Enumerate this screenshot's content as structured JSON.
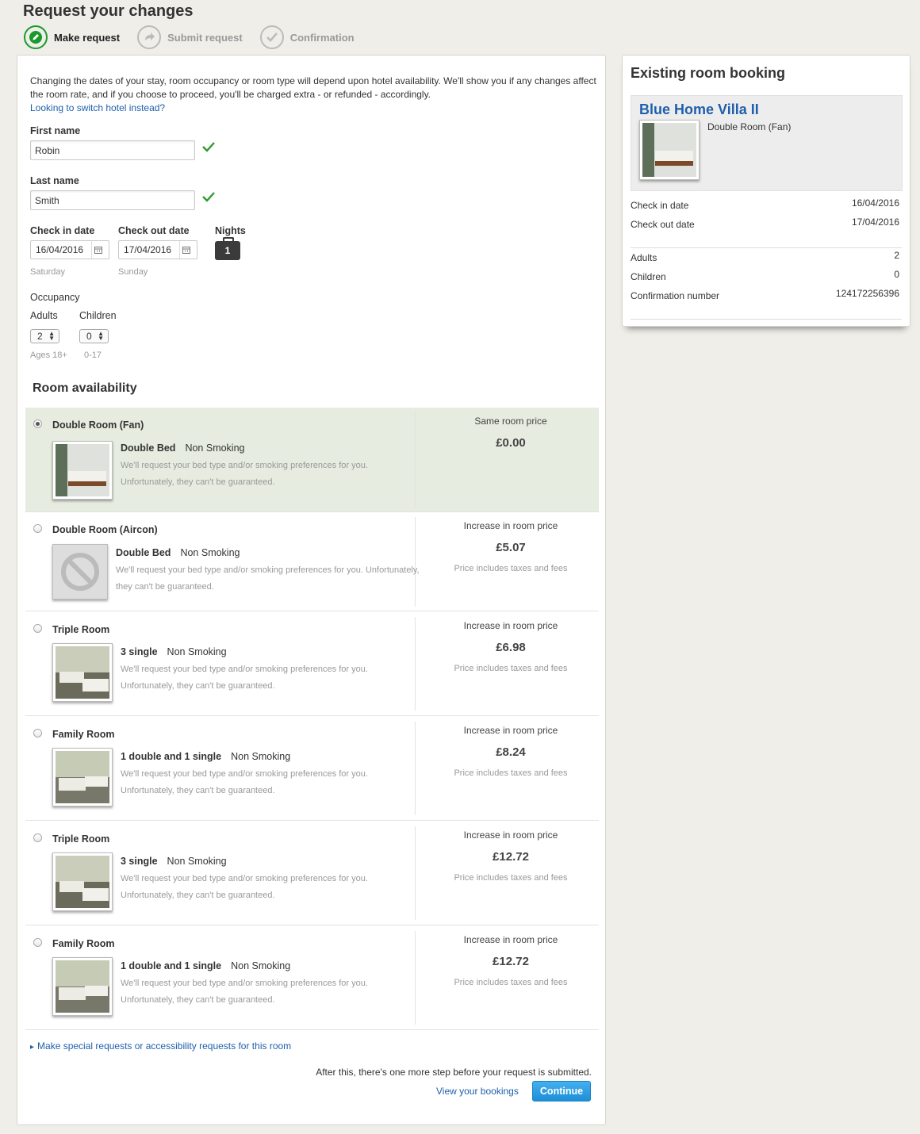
{
  "page_title": "Request your changes",
  "steps": [
    {
      "label": "Make request"
    },
    {
      "label": "Submit request"
    },
    {
      "label": "Confirmation"
    }
  ],
  "intro": {
    "text": "Changing the dates of your stay, room occupancy or room type will depend upon hotel availability. We'll show you if any changes affect the room rate, and if you choose to proceed, you'll be charged extra - or refunded - accordingly.",
    "switch_link": "Looking to switch hotel instead?"
  },
  "form": {
    "first_name_label": "First name",
    "first_name_value": "Robin",
    "last_name_label": "Last name",
    "last_name_value": "Smith",
    "check_in_label": "Check in date",
    "check_in_value": "16/04/2016",
    "check_in_day": "Saturday",
    "check_out_label": "Check out date",
    "check_out_value": "17/04/2016",
    "check_out_day": "Sunday",
    "nights_label": "Nights",
    "nights_value": "1",
    "occupancy_label": "Occupancy",
    "adults_label": "Adults",
    "adults_value": "2",
    "adults_hint": "Ages 18+",
    "children_label": "Children",
    "children_value": "0",
    "children_hint": "0-17"
  },
  "room_availability_title": "Room availability",
  "rooms": [
    {
      "name": "Double Room (Fan)",
      "bed": "Double Bed",
      "smoking": "Non Smoking",
      "note1": "We'll request your bed type and/or smoking preferences for you.",
      "note2": "Unfortunately, they can't be guaranteed.",
      "price_head": "Same room price",
      "price": "£0.00",
      "price_note": ""
    },
    {
      "name": "Double Room (Aircon)",
      "bed": "Double Bed",
      "smoking": "Non Smoking",
      "note1": "We'll request your bed type and/or smoking preferences for you. Unfortunately,",
      "note2": "they can't be guaranteed.",
      "price_head": "Increase in room price",
      "price": "£5.07",
      "price_note": "Price includes taxes and fees"
    },
    {
      "name": "Triple Room",
      "bed": "3 single",
      "smoking": "Non Smoking",
      "note1": "We'll request your bed type and/or smoking preferences for you.",
      "note2": "Unfortunately, they can't be guaranteed.",
      "price_head": "Increase in room price",
      "price": "£6.98",
      "price_note": "Price includes taxes and fees"
    },
    {
      "name": "Family Room",
      "bed": "1 double and 1 single",
      "smoking": "Non Smoking",
      "note1": "We'll request your bed type and/or smoking preferences for you.",
      "note2": "Unfortunately, they can't be guaranteed.",
      "price_head": "Increase in room price",
      "price": "£8.24",
      "price_note": "Price includes taxes and fees"
    },
    {
      "name": "Triple Room",
      "bed": "3 single",
      "smoking": "Non Smoking",
      "note1": "We'll request your bed type and/or smoking preferences for you.",
      "note2": "Unfortunately, they can't be guaranteed.",
      "price_head": "Increase in room price",
      "price": "£12.72",
      "price_note": "Price includes taxes and fees"
    },
    {
      "name": "Family Room",
      "bed": "1 double and 1 single",
      "smoking": "Non Smoking",
      "note1": "We'll request your bed type and/or smoking preferences for you.",
      "note2": "Unfortunately, they can't be guaranteed.",
      "price_head": "Increase in room price",
      "price": "£12.72",
      "price_note": "Price includes taxes and fees"
    }
  ],
  "special_requests_link": "Make special requests or accessibility requests for this room",
  "after_text": "After this, there's one more step before your request is submitted.",
  "view_bookings_link": "View your bookings",
  "continue_label": "Continue",
  "existing": {
    "title": "Existing room booking",
    "hotel_name": "Blue Home Villa II",
    "room_type": "Double Room (Fan)",
    "check_in_label": "Check in date",
    "check_in_value": "16/04/2016",
    "check_out_label": "Check out date",
    "check_out_value": "17/04/2016",
    "adults_label": "Adults",
    "adults_value": "2",
    "children_label": "Children",
    "children_value": "0",
    "confirmation_label": "Confirmation number",
    "confirmation_value": "124172256396"
  },
  "colors": {
    "accent_green": "#1a9a2a",
    "link_blue": "#1f5fab",
    "button_blue": "#2a9be0",
    "selected_row": "#e6ecdf"
  }
}
